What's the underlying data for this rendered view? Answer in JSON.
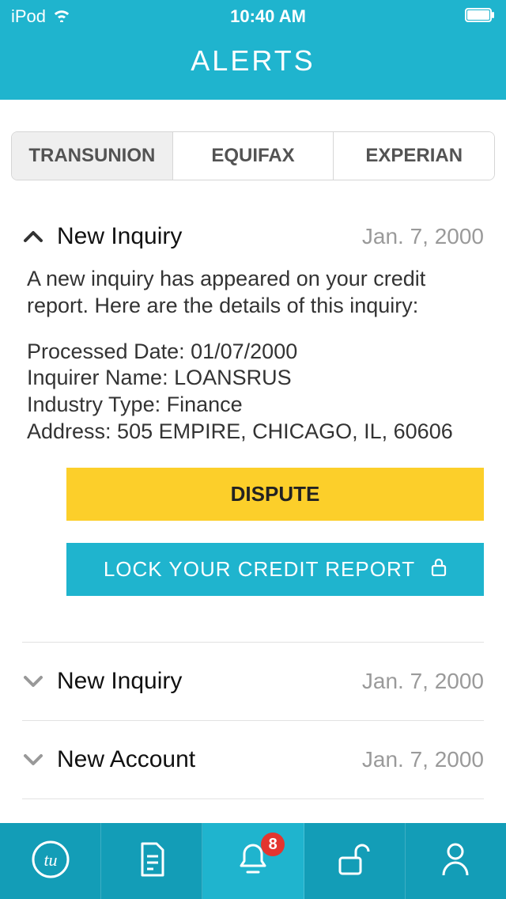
{
  "status": {
    "device": "iPod",
    "time": "10:40 AM"
  },
  "header": {
    "title": "ALERTS"
  },
  "tabs": [
    {
      "label": "TRANSUNION",
      "selected": true
    },
    {
      "label": "EQUIFAX",
      "selected": false
    },
    {
      "label": "EXPERIAN",
      "selected": false
    }
  ],
  "alerts": [
    {
      "title": "New Inquiry",
      "date": "Jan. 7, 2000",
      "expanded": true,
      "description": "A new inquiry has appeared on your credit report.  Here are the details of this inquiry:",
      "fields": [
        "Processed Date: 01/07/2000",
        "Inquirer Name: LOANSRUS",
        "Industry Type: Finance",
        "Address: 505 EMPIRE, CHICAGO, IL, 60606"
      ],
      "buttons": {
        "dispute": "DISPUTE",
        "lock": "LOCK YOUR CREDIT REPORT"
      }
    },
    {
      "title": "New Inquiry",
      "date": "Jan. 7, 2000",
      "expanded": false
    },
    {
      "title": "New Account",
      "date": "Jan. 7, 2000",
      "expanded": false
    }
  ],
  "nav": {
    "badge": "8"
  }
}
